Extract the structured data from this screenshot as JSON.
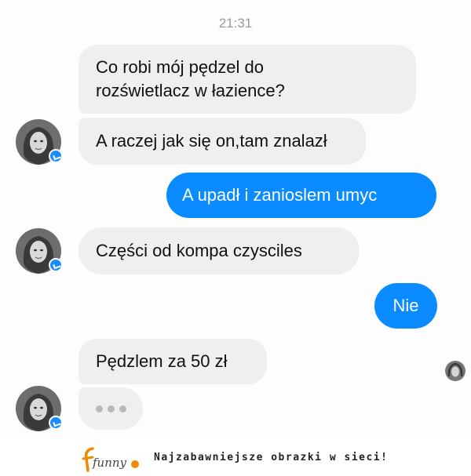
{
  "header": {
    "time": "21:31"
  },
  "messages": [
    {
      "from": "them",
      "lines": [
        "Co robi mój pędzel do",
        "rozświetlacz w łazience?"
      ]
    },
    {
      "from": "them",
      "text": "A raczej jak się on,tam znalazł"
    },
    {
      "from": "me",
      "text": "A upadł i zanioslem umyc"
    },
    {
      "from": "them",
      "text": "Części od kompa czysciles"
    },
    {
      "from": "me",
      "text": "Nie"
    },
    {
      "from": "them",
      "text": "Pędzlem za 50 zł"
    }
  ],
  "typing_indicator": {
    "icon": "typing-dots-icon"
  },
  "icons": {
    "avatar": "contact-avatar",
    "badge": "messenger-badge-icon",
    "read_receipt": "read-receipt-avatar"
  },
  "colors": {
    "incoming_bubble": "#efefef",
    "outgoing_bubble": "#0a8bff",
    "outgoing_text": "#ffffff"
  },
  "footer": {
    "logo_text": "funny",
    "slogan": "Najzabawniejsze obrazki w sieci!"
  }
}
